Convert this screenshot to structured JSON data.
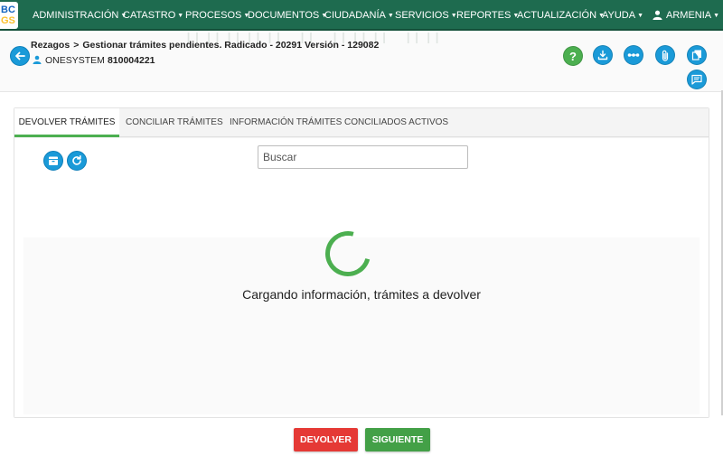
{
  "logo": {
    "line1": "BC",
    "line2": "GS"
  },
  "nav": {
    "items": [
      {
        "label": "ADMINISTRACIÓN"
      },
      {
        "label": "CATASTRO"
      },
      {
        "label": "PROCESOS"
      },
      {
        "label": "DOCUMENTOS"
      },
      {
        "label": "CIUDADANÍA"
      },
      {
        "label": "SERVICIOS"
      },
      {
        "label": "REPORTES"
      },
      {
        "label": "ACTUALIZACIÓN"
      },
      {
        "label": "AYUDA"
      }
    ],
    "user": "ARMENIA",
    "caret": "▼"
  },
  "header": {
    "breadcrumb_root": "Rezagos",
    "breadcrumb_sep": ">",
    "breadcrumb_current": "Gestionar trámites pendientes. Radicado - 20291 Versión - 129082",
    "company_name": "ONESYSTEM",
    "company_id": "810004221",
    "help_label": "?"
  },
  "tabs": [
    {
      "label": "DEVOLVER TRÁMITES",
      "active": true
    },
    {
      "label": "CONCILIAR TRÁMITES",
      "active": false
    },
    {
      "label": "INFORMACIÓN TRÁMITES CONCILIADOS ACTIVOS",
      "active": false
    }
  ],
  "search": {
    "placeholder": "Buscar",
    "value": ""
  },
  "loading": {
    "message": "Cargando información, trámites a devolver"
  },
  "actions": {
    "return_label": "DEVOLVER",
    "next_label": "SIGUIENTE"
  },
  "colors": {
    "nav_bg": "#1e6b4f",
    "accent_blue": "#1a9ad8",
    "accent_green": "#4caf50",
    "danger": "#e53935"
  },
  "icons": [
    "back-arrow-icon",
    "person-icon",
    "help-icon",
    "download-icon",
    "flow-icon",
    "attachment-icon",
    "copy-icon",
    "notes-icon",
    "archive-icon",
    "refresh-icon",
    "user-icon"
  ]
}
